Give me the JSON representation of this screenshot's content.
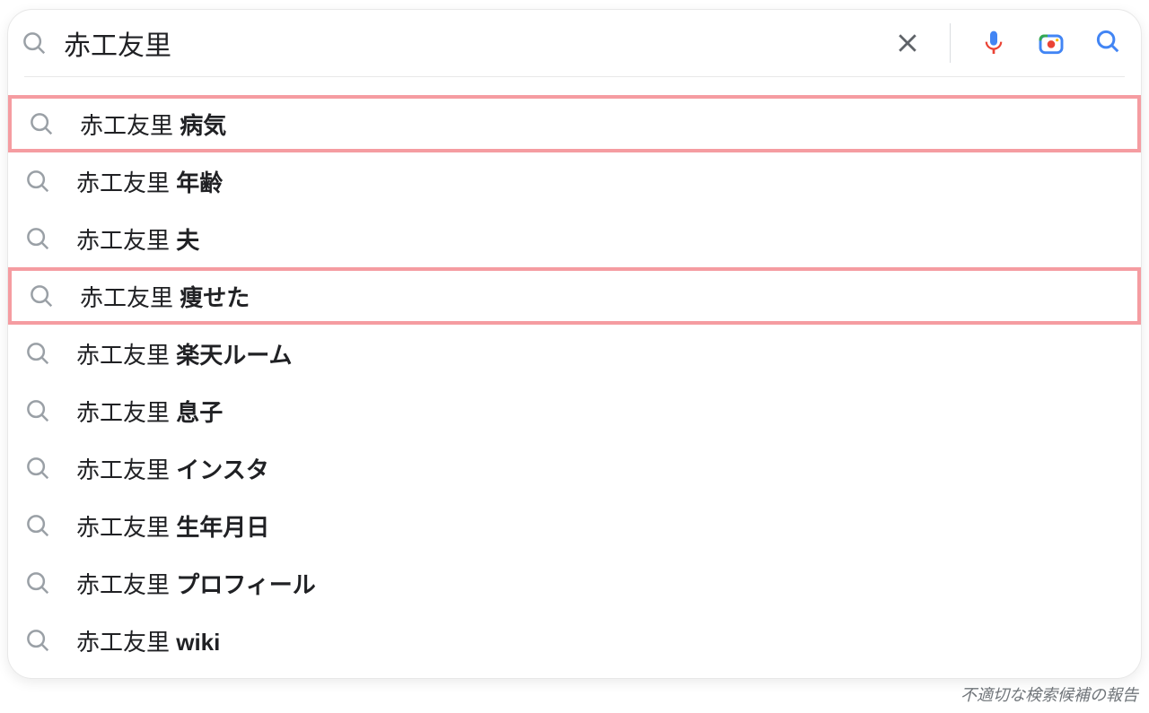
{
  "search": {
    "query": "赤工友里",
    "placeholder": ""
  },
  "suggestions": [
    {
      "base": "赤工友里 ",
      "extra": "病気",
      "highlight": true
    },
    {
      "base": "赤工友里 ",
      "extra": "年齢",
      "highlight": false
    },
    {
      "base": "赤工友里 ",
      "extra": "夫",
      "highlight": false
    },
    {
      "base": "赤工友里 ",
      "extra": "痩せた",
      "highlight": true
    },
    {
      "base": "赤工友里 ",
      "extra": "楽天ルーム",
      "highlight": false
    },
    {
      "base": "赤工友里 ",
      "extra": "息子",
      "highlight": false
    },
    {
      "base": "赤工友里 ",
      "extra": "インスタ",
      "highlight": false
    },
    {
      "base": "赤工友里 ",
      "extra": "生年月日",
      "highlight": false
    },
    {
      "base": "赤工友里 ",
      "extra": "プロフィール",
      "highlight": false
    },
    {
      "base": "赤工友里 ",
      "extra": "wiki",
      "highlight": false
    }
  ],
  "footer": {
    "report_label": "不適切な検索候補の報告"
  },
  "icons": {
    "search": "search-icon",
    "clear": "close-icon",
    "mic": "microphone-icon",
    "lens": "camera-lens-icon",
    "submit": "search-submit-icon"
  }
}
